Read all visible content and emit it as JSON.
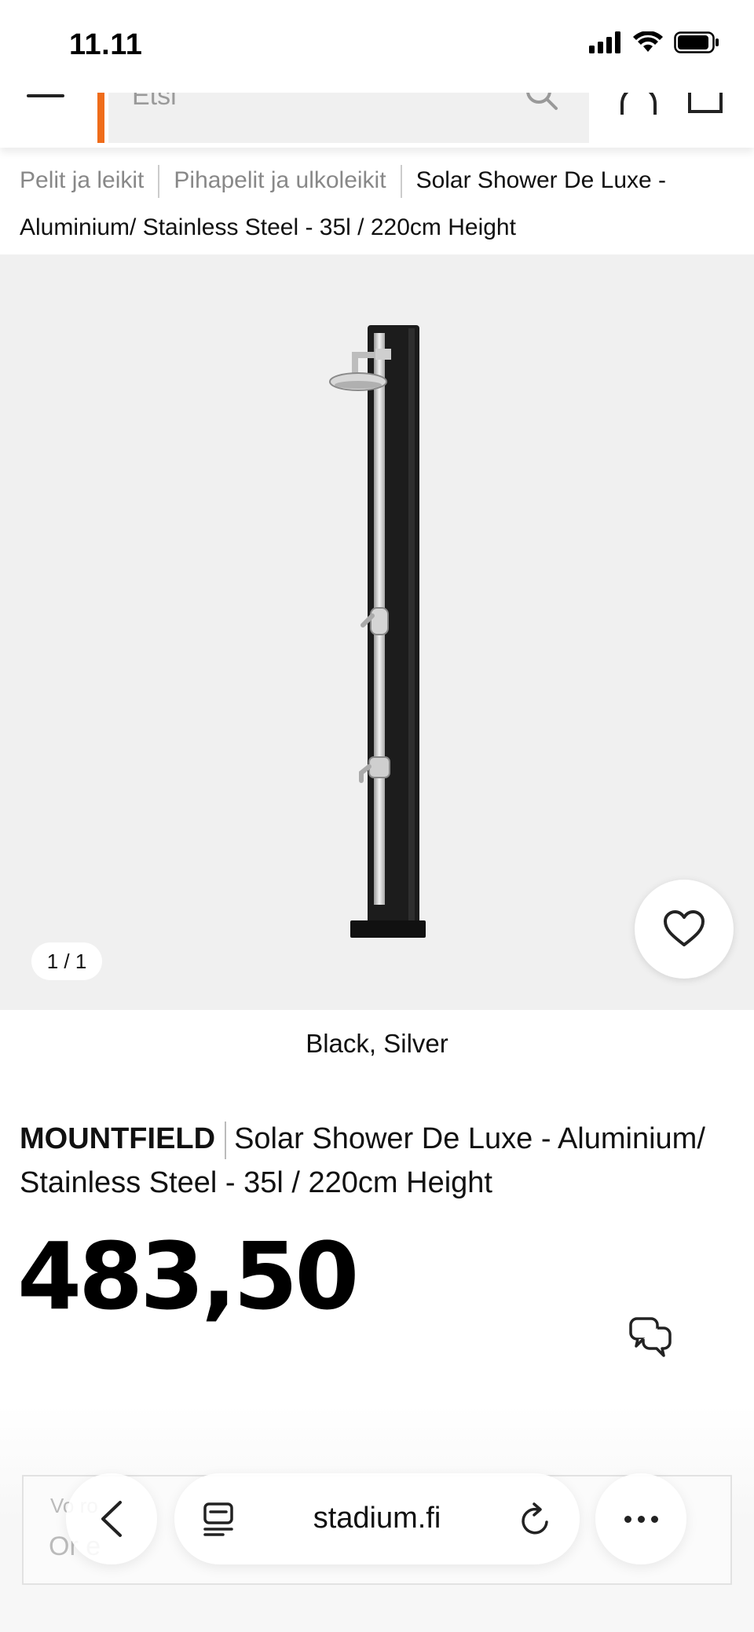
{
  "status_bar": {
    "time": "11.11",
    "icons": [
      "signal-icon",
      "wifi-icon",
      "battery-icon"
    ]
  },
  "header": {
    "search_placeholder": "Etsi",
    "icons": [
      "menu-icon",
      "search-icon",
      "account-icon",
      "cart-icon"
    ],
    "accent_color": "#ef6c1a"
  },
  "breadcrumb": {
    "items": [
      "Pelit ja leikit",
      "Pihapelit ja ulkoleikit"
    ],
    "current": "Solar Shower De Luxe - Aluminium/ Stainless Steel - 35l / 220cm Height"
  },
  "gallery": {
    "counter": "1 / 1",
    "favorite_icon": "heart-icon"
  },
  "product": {
    "color": "Black, Silver",
    "brand": "MOUNTFIELD",
    "name": "Solar Shower De Luxe - Aluminium/ Stainless Steel - 35l / 220cm Height",
    "price": "483,50"
  },
  "chat": {
    "icon": "chat-icon"
  },
  "delivery": {
    "label": "Vo    ro",
    "value": "Or      e"
  },
  "browser": {
    "url": "stadium.fi",
    "icons": [
      "back-icon",
      "tabs-icon",
      "reload-icon",
      "more-icon"
    ]
  }
}
